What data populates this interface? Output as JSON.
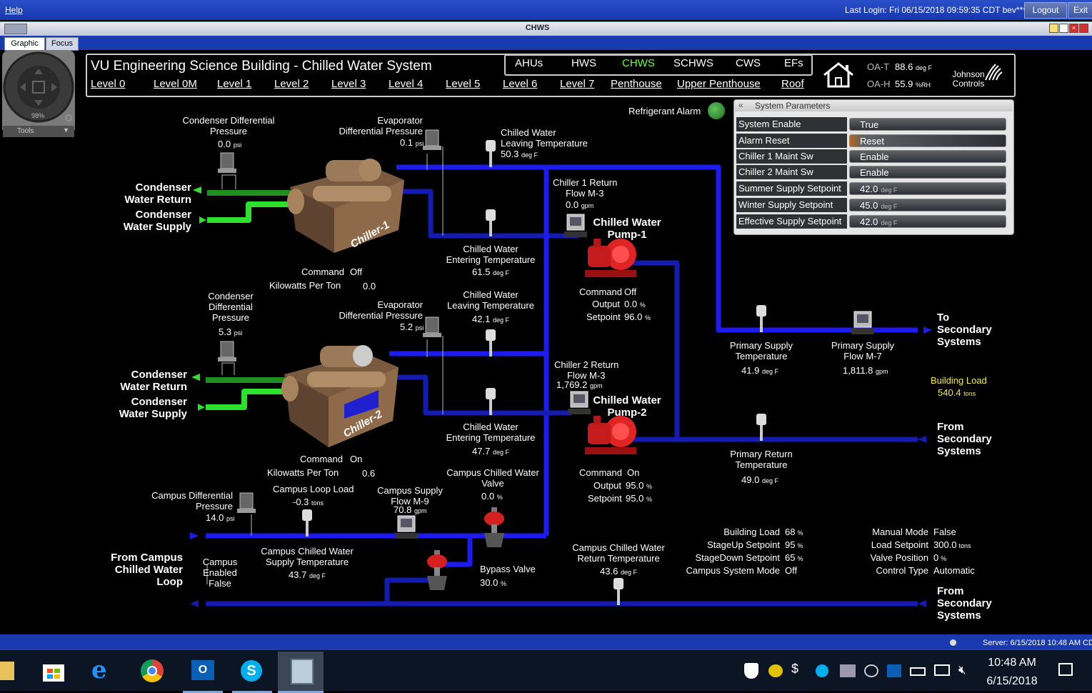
{
  "topbar": {
    "help": "Help",
    "last_login": "Last Login: Fri 06/15/2018 09:59:35 CDT bev***",
    "logout": "Logout",
    "exit": "Exit"
  },
  "window": {
    "title": "CHWS"
  },
  "tabs": [
    "Graphic",
    "Focus"
  ],
  "navigator": {
    "zoom": "98%",
    "tools": "Tools"
  },
  "header": {
    "title": "VU Engineering Science Building - Chilled Water System",
    "levels": [
      "Level 0",
      "Level 0M",
      "Level 1",
      "Level 2",
      "Level 3",
      "Level 4",
      "Level 5",
      "Level 6",
      "Level 7",
      "Penthouse",
      "Upper Penthouse",
      "Roof"
    ],
    "systems": [
      "AHUs",
      "HWS",
      "CHWS",
      "SCHWS",
      "CWS",
      "EFs"
    ],
    "active_system": "CHWS",
    "oat_label": "OA-T",
    "oat_value": "88.6",
    "oat_unit": "deg F",
    "oah_label": "OA-H",
    "oah_value": "55.9",
    "oah_unit": "%RH",
    "brand": "Johnson Controls"
  },
  "refrigerant_alarm": "Refrigerant Alarm",
  "system_parameters": {
    "title": "System Parameters",
    "rows": [
      {
        "label": "System Enable",
        "value": "True",
        "unit": ""
      },
      {
        "label": "Alarm Reset",
        "value": "Reset",
        "unit": ""
      },
      {
        "label": "Chiller 1 Maint Sw",
        "value": "Enable",
        "unit": ""
      },
      {
        "label": "Chiller 2 Maint Sw",
        "value": "Enable",
        "unit": ""
      },
      {
        "label": "Summer Supply Setpoint",
        "value": "42.0",
        "unit": "deg F"
      },
      {
        "label": "Winter Supply Setpoint",
        "value": "45.0",
        "unit": "deg F"
      },
      {
        "label": "Effective Supply Setpoint",
        "value": "42.0",
        "unit": "deg F"
      }
    ]
  },
  "chiller1": {
    "name": "Chiller-1",
    "cond_dp_label1": "Condenser Differential",
    "cond_dp_label2": "Pressure",
    "cond_dp_value": "0.0",
    "psi": "psi",
    "evap_dp_label1": "Evaporator",
    "evap_dp_label2": "Differential Pressure",
    "evap_dp_value": "0.1",
    "cw_return": [
      "Condenser",
      "Water Return"
    ],
    "cw_supply": [
      "Condenser",
      "Water Supply"
    ],
    "lwt_label1": "Chilled Water",
    "lwt_label2": "Leaving Temperature",
    "lwt_value": "50.3",
    "degf": "deg F",
    "ewt_label1": "Chilled Water",
    "ewt_label2": "Entering Temperature",
    "ewt_value": "61.5",
    "command_label": "Command",
    "command_value": "Off",
    "kwpt_label": "Kilowatts Per Ton",
    "kwpt_value": "0.0",
    "return_flow_label1": "Chiller 1 Return",
    "return_flow_label2": "Flow M-3",
    "return_flow_value": "0.0",
    "gpm": "gpm"
  },
  "pump1": {
    "name1": "Chilled Water",
    "name2": "Pump-1",
    "command_label": "Command",
    "command_value": "Off",
    "output_label": "Output",
    "output_value": "0.0",
    "pct": "%",
    "setpoint_label": "Setpoint",
    "setpoint_value": "96.0"
  },
  "chiller2": {
    "name": "Chiller-2",
    "cond_dp_label1": "Condenser",
    "cond_dp_label2": "Differential",
    "cond_dp_label3": "Pressure",
    "cond_dp_value": "5.3",
    "evap_dp_label1": "Evaporator",
    "evap_dp_label2": "Differential Pressure",
    "evap_dp_value": "5.2",
    "cw_return": [
      "Condenser",
      "Water Return"
    ],
    "cw_supply": [
      "Condenser",
      "Water Supply"
    ],
    "lwt_label1": "Chilled Water",
    "lwt_label2": "Leaving Temperature",
    "lwt_value": "42.1",
    "ewt_label1": "Chilled Water",
    "ewt_label2": "Entering Temperature",
    "ewt_value": "47.7",
    "command_label": "Command",
    "command_value": "On",
    "kwpt_label": "Kilowatts Per Ton",
    "kwpt_value": "0.6",
    "return_flow_label1": "Chiller 2 Return",
    "return_flow_label2": "Flow M-3",
    "return_flow_value": "1,769.2"
  },
  "pump2": {
    "name1": "Chilled Water",
    "name2": "Pump-2",
    "command_label": "Command",
    "command_value": "On",
    "output_label": "Output",
    "output_value": "95.0",
    "setpoint_label": "Setpoint",
    "setpoint_value": "95.0"
  },
  "primary": {
    "supply_temp_label1": "Primary Supply",
    "supply_temp_label2": "Temperature",
    "supply_temp_value": "41.9",
    "supply_flow_label1": "Primary Supply",
    "supply_flow_label2": "Flow M-7",
    "supply_flow_value": "1,811.8",
    "return_temp_label1": "Primary Return",
    "return_temp_label2": "Temperature",
    "return_temp_value": "49.0",
    "to_secondary": [
      "To",
      "Secondary",
      "Systems"
    ],
    "from_secondary": [
      "From",
      "Secondary",
      "Systems"
    ],
    "building_load_label": "Building Load",
    "building_load_value": "540.4",
    "tons": "tons"
  },
  "campus": {
    "dp_label1": "Campus Differential",
    "dp_label2": "Pressure",
    "dp_value": "14.0",
    "loop_load_label": "Campus Loop Load",
    "loop_load_value": "-0.3",
    "supply_flow_label1": "Campus Supply",
    "supply_flow_label2": "Flow M-9",
    "supply_flow_value": "70.8",
    "valve_label1": "Campus Chilled Water",
    "valve_label2": "Valve",
    "valve_value": "0.0",
    "supply_temp_label1": "Campus Chilled Water",
    "supply_temp_label2": "Supply Temperature",
    "supply_temp_value": "43.7",
    "from_campus": [
      "From Campus",
      "Chilled Water",
      "Loop"
    ],
    "enabled_label1": "Campus",
    "enabled_label2": "Enabled",
    "enabled_value": "False",
    "bypass_label": "Bypass Valve",
    "bypass_value": "30.0",
    "return_temp_label1": "Campus Chilled Water",
    "return_temp_label2": "Return Temperature",
    "return_temp_value": "43.6",
    "from_secondary": [
      "From",
      "Secondary",
      "Systems"
    ]
  },
  "staging": {
    "rows": [
      {
        "label": "Building Load",
        "value": "68",
        "unit": "%"
      },
      {
        "label": "StageUp Setpoint",
        "value": "95",
        "unit": "%"
      },
      {
        "label": "StageDown Setpoint",
        "value": "65",
        "unit": "%"
      },
      {
        "label": "Campus System Mode",
        "value": "Off",
        "unit": ""
      }
    ],
    "rows2": [
      {
        "label": "Manual Mode",
        "value": "False",
        "unit": ""
      },
      {
        "label": "Load Setpoint",
        "value": "300.0",
        "unit": "tons"
      },
      {
        "label": "Valve Position",
        "value": "0",
        "unit": "%"
      },
      {
        "label": "Control Type",
        "value": "Automatic",
        "unit": ""
      }
    ]
  },
  "status": {
    "server": "Server: 6/15/2018 10:48 AM CD"
  },
  "taskbar": {
    "time": "10:48 AM",
    "date": "6/15/2018"
  },
  "colors": {
    "pipe_blue": "#1c1cf0",
    "pipe_dark_blue": "#141cb0",
    "condenser_green": "#22c022",
    "pump_red": "#d42020",
    "accent_green": "#5aff2a"
  }
}
